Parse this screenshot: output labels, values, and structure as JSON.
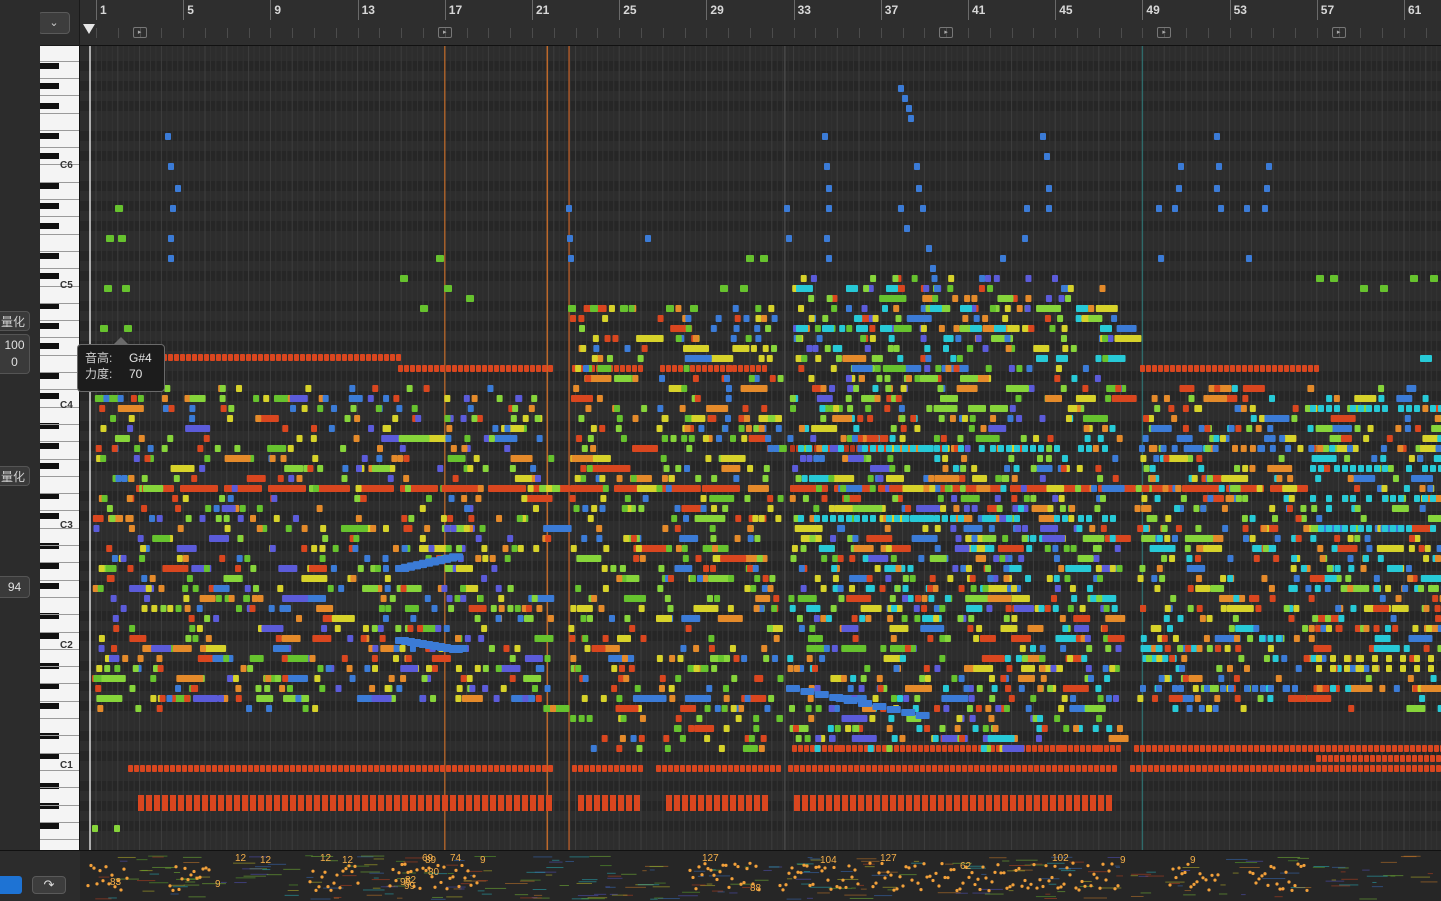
{
  "app": {
    "name": "Piano Roll"
  },
  "toolbar": {
    "collapse_icon": "collapse-icon"
  },
  "inspector": {
    "quantize_label_1": "量化",
    "quantize_value_1": "100",
    "quantize_value_2": "0",
    "quantize_label_2": "量化",
    "velocity_value": "94"
  },
  "ruler": {
    "bars": [
      "1",
      "5",
      "9",
      "13",
      "17",
      "21",
      "25",
      "29",
      "33",
      "37",
      "41",
      "45",
      "49",
      "53",
      "57",
      "61"
    ],
    "markers_at_bars": [
      3,
      17,
      40,
      50,
      58
    ]
  },
  "keyboard": {
    "octave_labels": [
      "C6",
      "C5",
      "C4",
      "C3",
      "C2",
      "C1"
    ]
  },
  "tooltip": {
    "pitch_label": "音高:",
    "pitch_value": "G#4",
    "velocity_label": "力度:",
    "velocity_value": "70"
  },
  "automation": {
    "values": [
      "83",
      "9",
      "12",
      "12",
      "12",
      "12",
      "95",
      "89",
      "82",
      "69",
      "74",
      "9",
      "99",
      "80",
      "127",
      "88",
      "104",
      "127",
      "62",
      "102",
      "9",
      "9"
    ]
  },
  "colors": {
    "red": "#d9461f",
    "orange": "#e48a2a",
    "yellow": "#d6d22a",
    "green": "#66c22e",
    "lime": "#86d43a",
    "cyan": "#27c9d6",
    "blue": "#3b7bd6",
    "indigo": "#5b5bd9",
    "background": "#2b2b2b"
  }
}
